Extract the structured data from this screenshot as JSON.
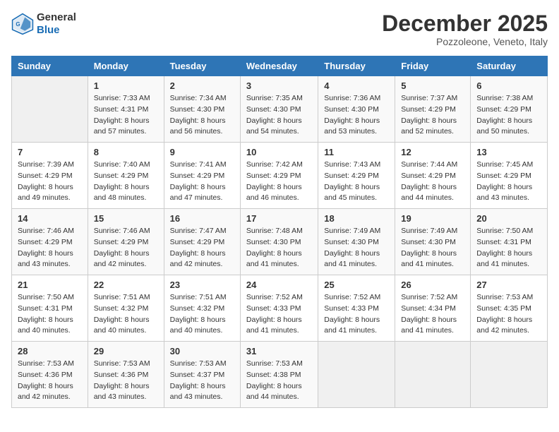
{
  "logo": {
    "line1": "General",
    "line2": "Blue"
  },
  "title": "December 2025",
  "subtitle": "Pozzoleone, Veneto, Italy",
  "days_header": [
    "Sunday",
    "Monday",
    "Tuesday",
    "Wednesday",
    "Thursday",
    "Friday",
    "Saturday"
  ],
  "weeks": [
    [
      {
        "day": "",
        "info": ""
      },
      {
        "day": "1",
        "info": "Sunrise: 7:33 AM\nSunset: 4:31 PM\nDaylight: 8 hours\nand 57 minutes."
      },
      {
        "day": "2",
        "info": "Sunrise: 7:34 AM\nSunset: 4:30 PM\nDaylight: 8 hours\nand 56 minutes."
      },
      {
        "day": "3",
        "info": "Sunrise: 7:35 AM\nSunset: 4:30 PM\nDaylight: 8 hours\nand 54 minutes."
      },
      {
        "day": "4",
        "info": "Sunrise: 7:36 AM\nSunset: 4:30 PM\nDaylight: 8 hours\nand 53 minutes."
      },
      {
        "day": "5",
        "info": "Sunrise: 7:37 AM\nSunset: 4:29 PM\nDaylight: 8 hours\nand 52 minutes."
      },
      {
        "day": "6",
        "info": "Sunrise: 7:38 AM\nSunset: 4:29 PM\nDaylight: 8 hours\nand 50 minutes."
      }
    ],
    [
      {
        "day": "7",
        "info": "Sunrise: 7:39 AM\nSunset: 4:29 PM\nDaylight: 8 hours\nand 49 minutes."
      },
      {
        "day": "8",
        "info": "Sunrise: 7:40 AM\nSunset: 4:29 PM\nDaylight: 8 hours\nand 48 minutes."
      },
      {
        "day": "9",
        "info": "Sunrise: 7:41 AM\nSunset: 4:29 PM\nDaylight: 8 hours\nand 47 minutes."
      },
      {
        "day": "10",
        "info": "Sunrise: 7:42 AM\nSunset: 4:29 PM\nDaylight: 8 hours\nand 46 minutes."
      },
      {
        "day": "11",
        "info": "Sunrise: 7:43 AM\nSunset: 4:29 PM\nDaylight: 8 hours\nand 45 minutes."
      },
      {
        "day": "12",
        "info": "Sunrise: 7:44 AM\nSunset: 4:29 PM\nDaylight: 8 hours\nand 44 minutes."
      },
      {
        "day": "13",
        "info": "Sunrise: 7:45 AM\nSunset: 4:29 PM\nDaylight: 8 hours\nand 43 minutes."
      }
    ],
    [
      {
        "day": "14",
        "info": "Sunrise: 7:46 AM\nSunset: 4:29 PM\nDaylight: 8 hours\nand 43 minutes."
      },
      {
        "day": "15",
        "info": "Sunrise: 7:46 AM\nSunset: 4:29 PM\nDaylight: 8 hours\nand 42 minutes."
      },
      {
        "day": "16",
        "info": "Sunrise: 7:47 AM\nSunset: 4:29 PM\nDaylight: 8 hours\nand 42 minutes."
      },
      {
        "day": "17",
        "info": "Sunrise: 7:48 AM\nSunset: 4:30 PM\nDaylight: 8 hours\nand 41 minutes."
      },
      {
        "day": "18",
        "info": "Sunrise: 7:49 AM\nSunset: 4:30 PM\nDaylight: 8 hours\nand 41 minutes."
      },
      {
        "day": "19",
        "info": "Sunrise: 7:49 AM\nSunset: 4:30 PM\nDaylight: 8 hours\nand 41 minutes."
      },
      {
        "day": "20",
        "info": "Sunrise: 7:50 AM\nSunset: 4:31 PM\nDaylight: 8 hours\nand 41 minutes."
      }
    ],
    [
      {
        "day": "21",
        "info": "Sunrise: 7:50 AM\nSunset: 4:31 PM\nDaylight: 8 hours\nand 40 minutes."
      },
      {
        "day": "22",
        "info": "Sunrise: 7:51 AM\nSunset: 4:32 PM\nDaylight: 8 hours\nand 40 minutes."
      },
      {
        "day": "23",
        "info": "Sunrise: 7:51 AM\nSunset: 4:32 PM\nDaylight: 8 hours\nand 40 minutes."
      },
      {
        "day": "24",
        "info": "Sunrise: 7:52 AM\nSunset: 4:33 PM\nDaylight: 8 hours\nand 41 minutes."
      },
      {
        "day": "25",
        "info": "Sunrise: 7:52 AM\nSunset: 4:33 PM\nDaylight: 8 hours\nand 41 minutes."
      },
      {
        "day": "26",
        "info": "Sunrise: 7:52 AM\nSunset: 4:34 PM\nDaylight: 8 hours\nand 41 minutes."
      },
      {
        "day": "27",
        "info": "Sunrise: 7:53 AM\nSunset: 4:35 PM\nDaylight: 8 hours\nand 42 minutes."
      }
    ],
    [
      {
        "day": "28",
        "info": "Sunrise: 7:53 AM\nSunset: 4:36 PM\nDaylight: 8 hours\nand 42 minutes."
      },
      {
        "day": "29",
        "info": "Sunrise: 7:53 AM\nSunset: 4:36 PM\nDaylight: 8 hours\nand 43 minutes."
      },
      {
        "day": "30",
        "info": "Sunrise: 7:53 AM\nSunset: 4:37 PM\nDaylight: 8 hours\nand 43 minutes."
      },
      {
        "day": "31",
        "info": "Sunrise: 7:53 AM\nSunset: 4:38 PM\nDaylight: 8 hours\nand 44 minutes."
      },
      {
        "day": "",
        "info": ""
      },
      {
        "day": "",
        "info": ""
      },
      {
        "day": "",
        "info": ""
      }
    ]
  ]
}
